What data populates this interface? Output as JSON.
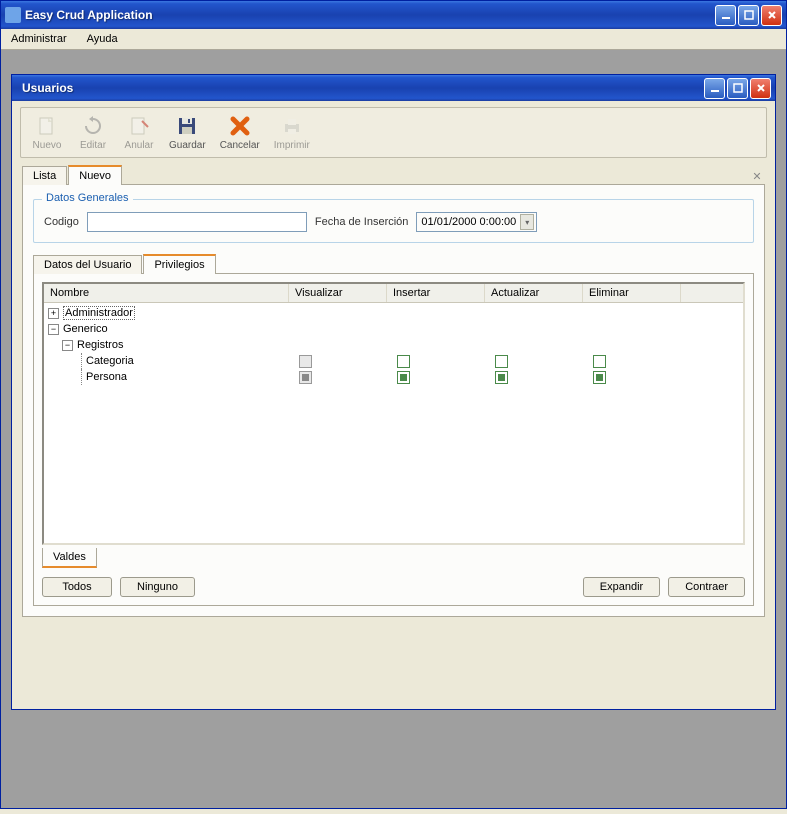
{
  "app": {
    "title": "Easy Crud Application"
  },
  "menubar": {
    "admin": "Administrar",
    "help": "Ayuda"
  },
  "child": {
    "title": "Usuarios"
  },
  "toolbar": {
    "nuevo": "Nuevo",
    "editar": "Editar",
    "anular": "Anular",
    "guardar": "Guardar",
    "cancelar": "Cancelar",
    "imprimir": "Imprimir"
  },
  "tabs": {
    "lista": "Lista",
    "nuevo": "Nuevo"
  },
  "general": {
    "legend": "Datos Generales",
    "codigo_label": "Codigo",
    "codigo_value": "",
    "fecha_label": "Fecha de Inserción",
    "fecha_value": "01/01/2000 0:00:00"
  },
  "inner_tabs": {
    "datos": "Datos del Usuario",
    "priv": "Privilegios"
  },
  "priv_headers": {
    "nombre": "Nombre",
    "visualizar": "Visualizar",
    "insertar": "Insertar",
    "actualizar": "Actualizar",
    "eliminar": "Eliminar"
  },
  "tree": {
    "admin": "Administrador",
    "generico": "Generico",
    "registros": "Registros",
    "categoria": "Categoria",
    "persona": "Persona"
  },
  "bottom_tab": "Valdes",
  "buttons": {
    "todos": "Todos",
    "ninguno": "Ninguno",
    "expandir": "Expandir",
    "contraer": "Contraer"
  }
}
